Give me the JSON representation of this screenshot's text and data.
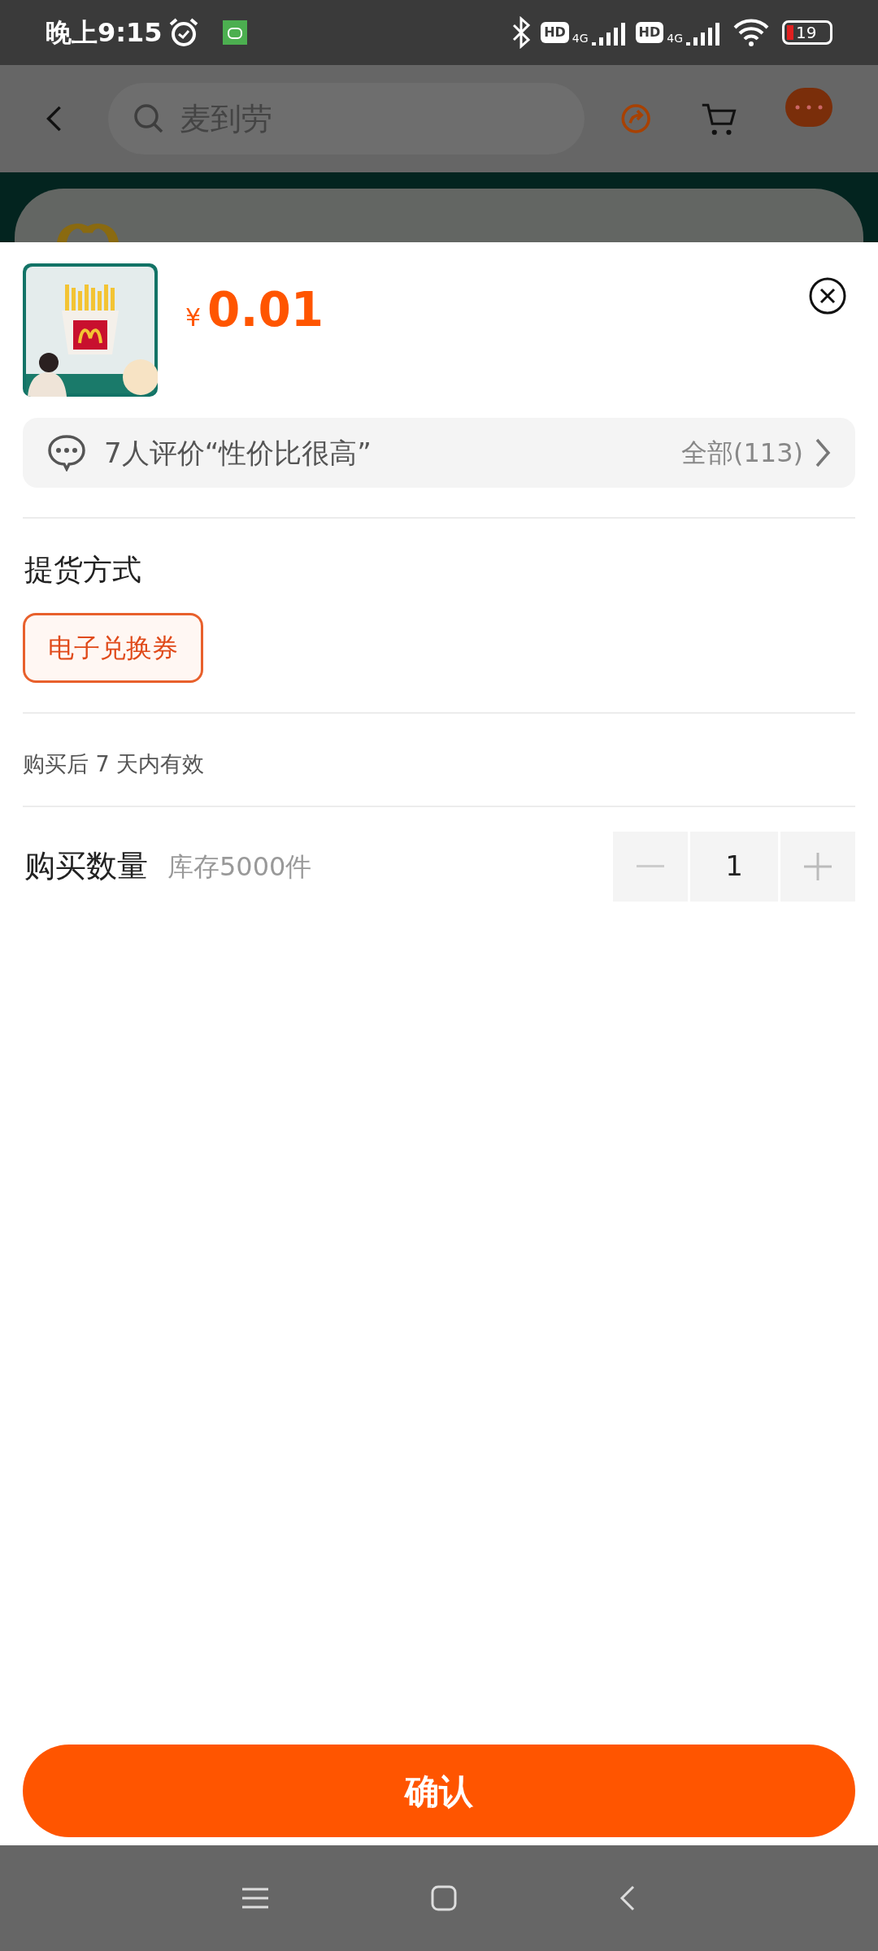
{
  "status_bar": {
    "time": "晚上9:15",
    "network_badges": [
      {
        "hd": "HD",
        "gen": "4G"
      },
      {
        "hd": "HD",
        "gen": "4G"
      }
    ],
    "battery": "19"
  },
  "header": {
    "search": {
      "placeholder": "麦到劳"
    }
  },
  "sheet": {
    "price": {
      "currency": "¥",
      "amount": "0.01"
    },
    "review": {
      "summary": "7人评价“性价比很高”",
      "all": "全部(113)"
    },
    "delivery": {
      "title": "提货方式",
      "options": [
        {
          "label": "电子兑换券",
          "selected": true
        }
      ]
    },
    "validity": "购买后 7 天内有效",
    "quantity": {
      "label": "购买数量",
      "stock": "库存5000件",
      "value": "1"
    },
    "confirm": "确认"
  }
}
